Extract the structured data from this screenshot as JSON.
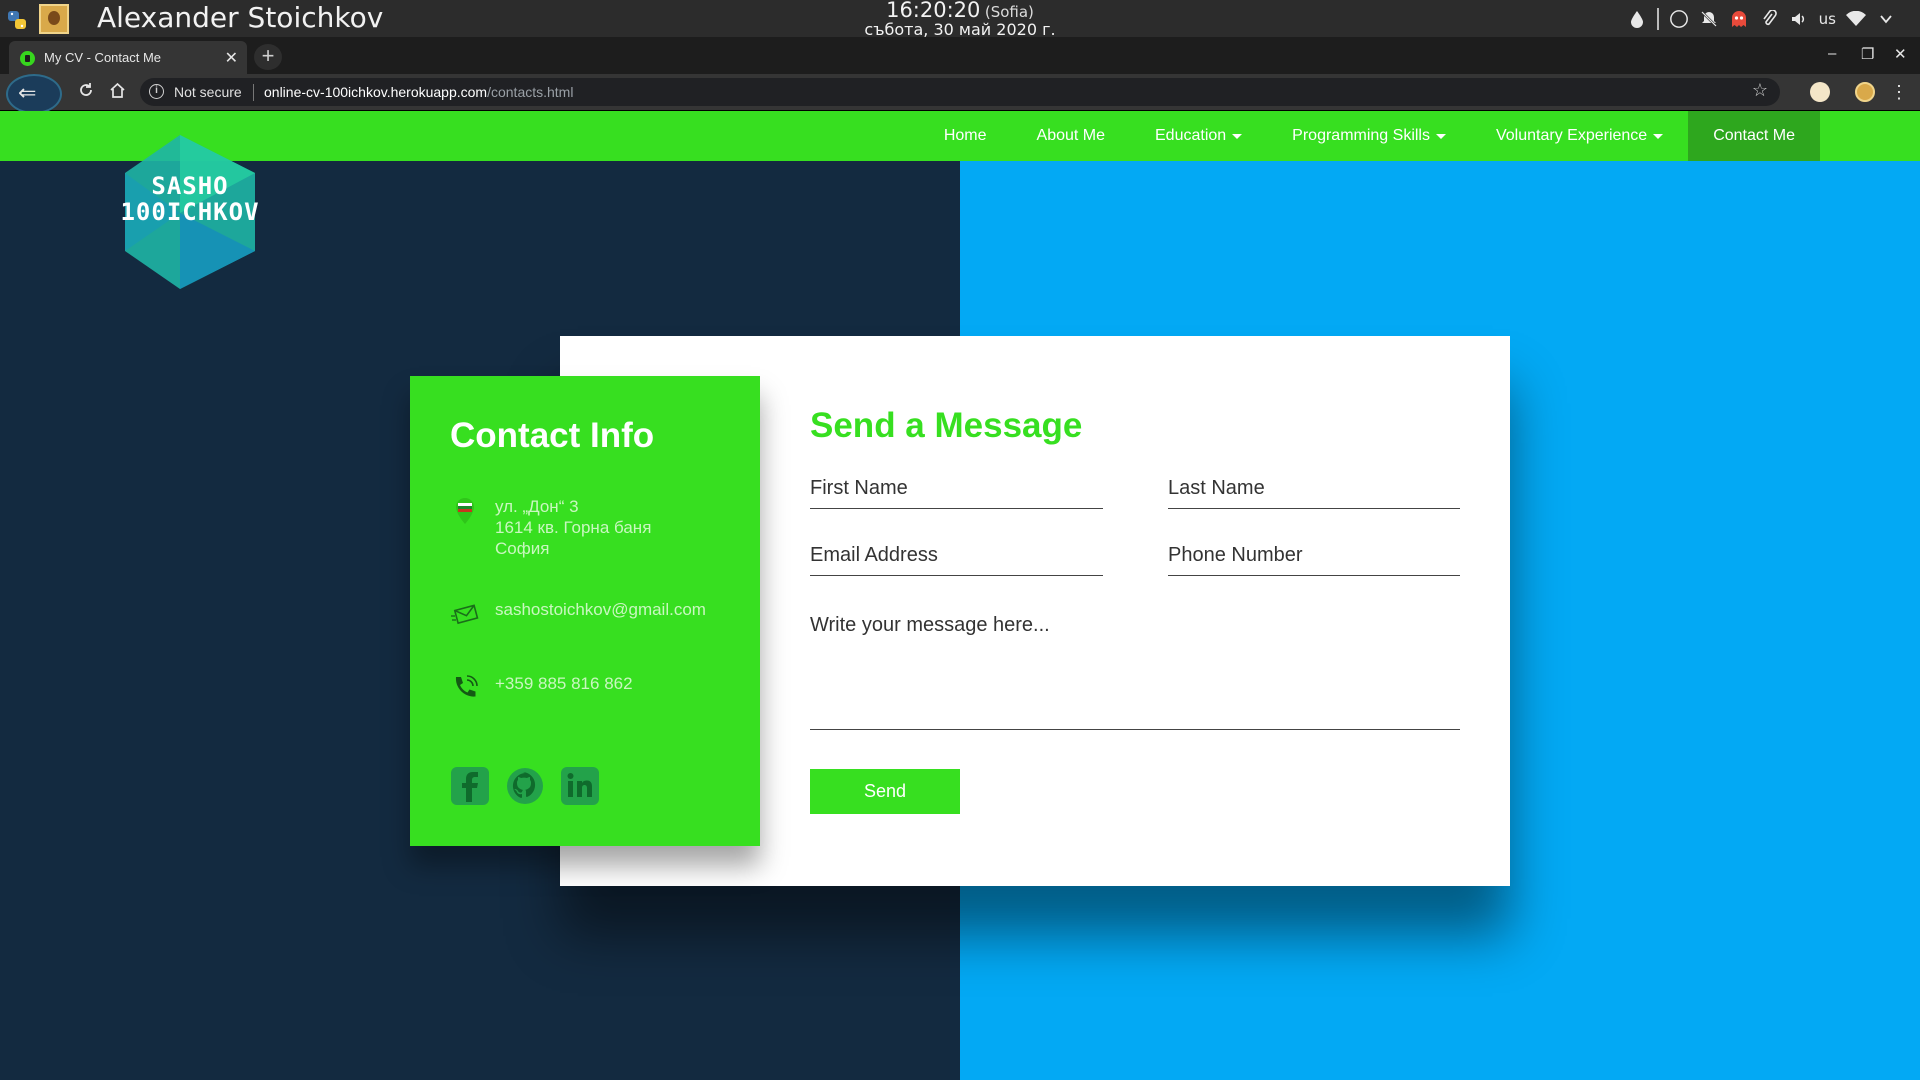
{
  "os_bar": {
    "user_name": "Alexander Stoichkov",
    "time": "16:20:20",
    "timezone": "(Sofia)",
    "date": "събота, 30 май 2020 г.",
    "keyboard_layout": "us"
  },
  "browser": {
    "tab_title": "My CV - Contact Me",
    "tab_close": "✕",
    "new_tab": "+",
    "security_label": "Not secure",
    "url_host": "online-cv-100ichkov.herokuapp.com",
    "url_path": "/contacts.html",
    "window_controls": [
      "–",
      "❐",
      "✕"
    ]
  },
  "nav": {
    "items": [
      {
        "label": "Home",
        "dropdown": false
      },
      {
        "label": "About Me",
        "dropdown": false
      },
      {
        "label": "Education",
        "dropdown": true
      },
      {
        "label": "Programming Skills",
        "dropdown": true
      },
      {
        "label": "Voluntary Experience",
        "dropdown": true
      },
      {
        "label": "Contact Me",
        "dropdown": false,
        "active": true
      }
    ]
  },
  "logo": {
    "line1": "SASHO",
    "line2": "100ICHKOV"
  },
  "contact_info": {
    "title": "Contact Info",
    "address_line1": "ул. „Дон“ 3",
    "address_line2": "1614 кв. Горна баня",
    "address_line3": "София",
    "email": "sashostoichkov@gmail.com",
    "phone": "+359 885 816 862",
    "socials": [
      "facebook-icon",
      "github-icon",
      "linkedin-icon"
    ]
  },
  "form": {
    "title": "Send a Message",
    "first_name_placeholder": "First Name",
    "last_name_placeholder": "Last Name",
    "email_placeholder": "Email Address",
    "phone_placeholder": "Phone Number",
    "message_placeholder": "Write your message here...",
    "send_label": "Send"
  },
  "colors": {
    "accent_green": "#37df20",
    "nav_active": "#2ea71e",
    "bg_dark": "#132a40",
    "bg_blue": "#03a9f4"
  }
}
